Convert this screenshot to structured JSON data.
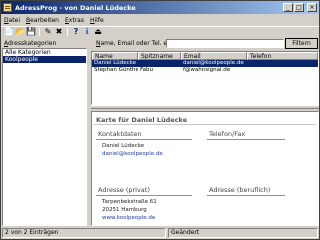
{
  "window": {
    "title": "AdressProg - von Daniel Lüdecke",
    "min_label": "_",
    "max_label": "□",
    "close_label": "×"
  },
  "menu": [
    {
      "hot": "D",
      "rest": "atei"
    },
    {
      "hot": "B",
      "rest": "earbeiten"
    },
    {
      "hot": "E",
      "rest": "xtras"
    },
    {
      "hot": "H",
      "rest": "ilfe"
    }
  ],
  "toolbar": {
    "new_icon": "📄",
    "open_icon": "📂",
    "save_icon": "💾",
    "edit_icon": "✎",
    "delete_icon": "✖",
    "help_icon": "?",
    "info_icon": "ℹ",
    "exit_icon": "⏏"
  },
  "categories": {
    "label_hot": "A",
    "label_rest": "dresskategorien",
    "items": [
      "Alle Kategorien",
      "Koolpeople"
    ],
    "selected_index": 1
  },
  "search": {
    "label_pre": "N",
    "label_rest": "ame, Email oder Tel. enthält",
    "value": "",
    "filter_label": "Filtern"
  },
  "table": {
    "columns": [
      "Name",
      "Spitzname",
      "Email",
      "Telefon"
    ],
    "rows": [
      {
        "name": "Daniel Lüdecke",
        "nick": "",
        "email": "daniel@koolpeople.de",
        "phone": ""
      },
      {
        "name": "Stephan Günther",
        "nick": "Fabu",
        "email": "f@wahnsignal.de",
        "phone": ""
      }
    ],
    "selected_index": 0
  },
  "card": {
    "title": "Karte für Daniel Lüdecke",
    "contact_title": "Kontaktdaten",
    "contact_name": "Daniel Lüdecke",
    "contact_email": "daniel@koolpeople.de",
    "phone_title": "Telefon/Fax",
    "address_private_title": "Adresse (privat)",
    "address_line1": "Tarpenbekstraße 61",
    "address_line2": "20251 Hamburg",
    "address_web": "www.koolpeople.de",
    "address_work_title": "Adresse (beruflich)"
  },
  "status": {
    "count": "2 von 2 Einträgen",
    "state": "Geändert"
  }
}
